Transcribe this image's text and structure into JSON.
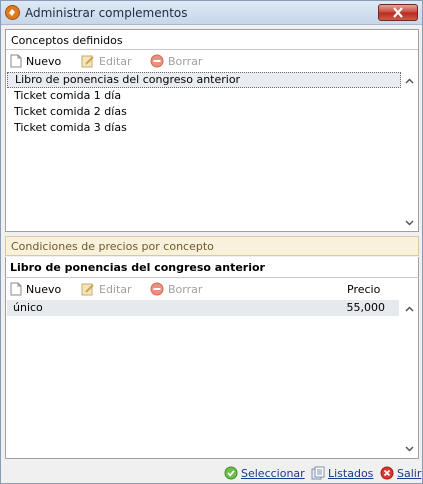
{
  "window": {
    "title": "Administrar complementos"
  },
  "conceptos": {
    "header": "Conceptos definidos",
    "toolbar": {
      "nuevo": "Nuevo",
      "editar": "Editar",
      "borrar": "Borrar"
    },
    "items": [
      "Libro de ponencias del congreso anterior",
      "Ticket comida 1 día",
      "Ticket comida 2 días",
      "Ticket comida 3 días"
    ]
  },
  "condiciones": {
    "header": "Condiciones de precios por concepto",
    "selected_concept": "Libro de ponencias del congreso anterior",
    "toolbar": {
      "nuevo": "Nuevo",
      "editar": "Editar",
      "borrar": "Borrar"
    },
    "price_header": "Precio",
    "rows": [
      {
        "name": "único",
        "price": "55,000"
      }
    ]
  },
  "footer": {
    "seleccionar": "Seleccionar",
    "listados": "Listados",
    "salir": "Salir"
  }
}
